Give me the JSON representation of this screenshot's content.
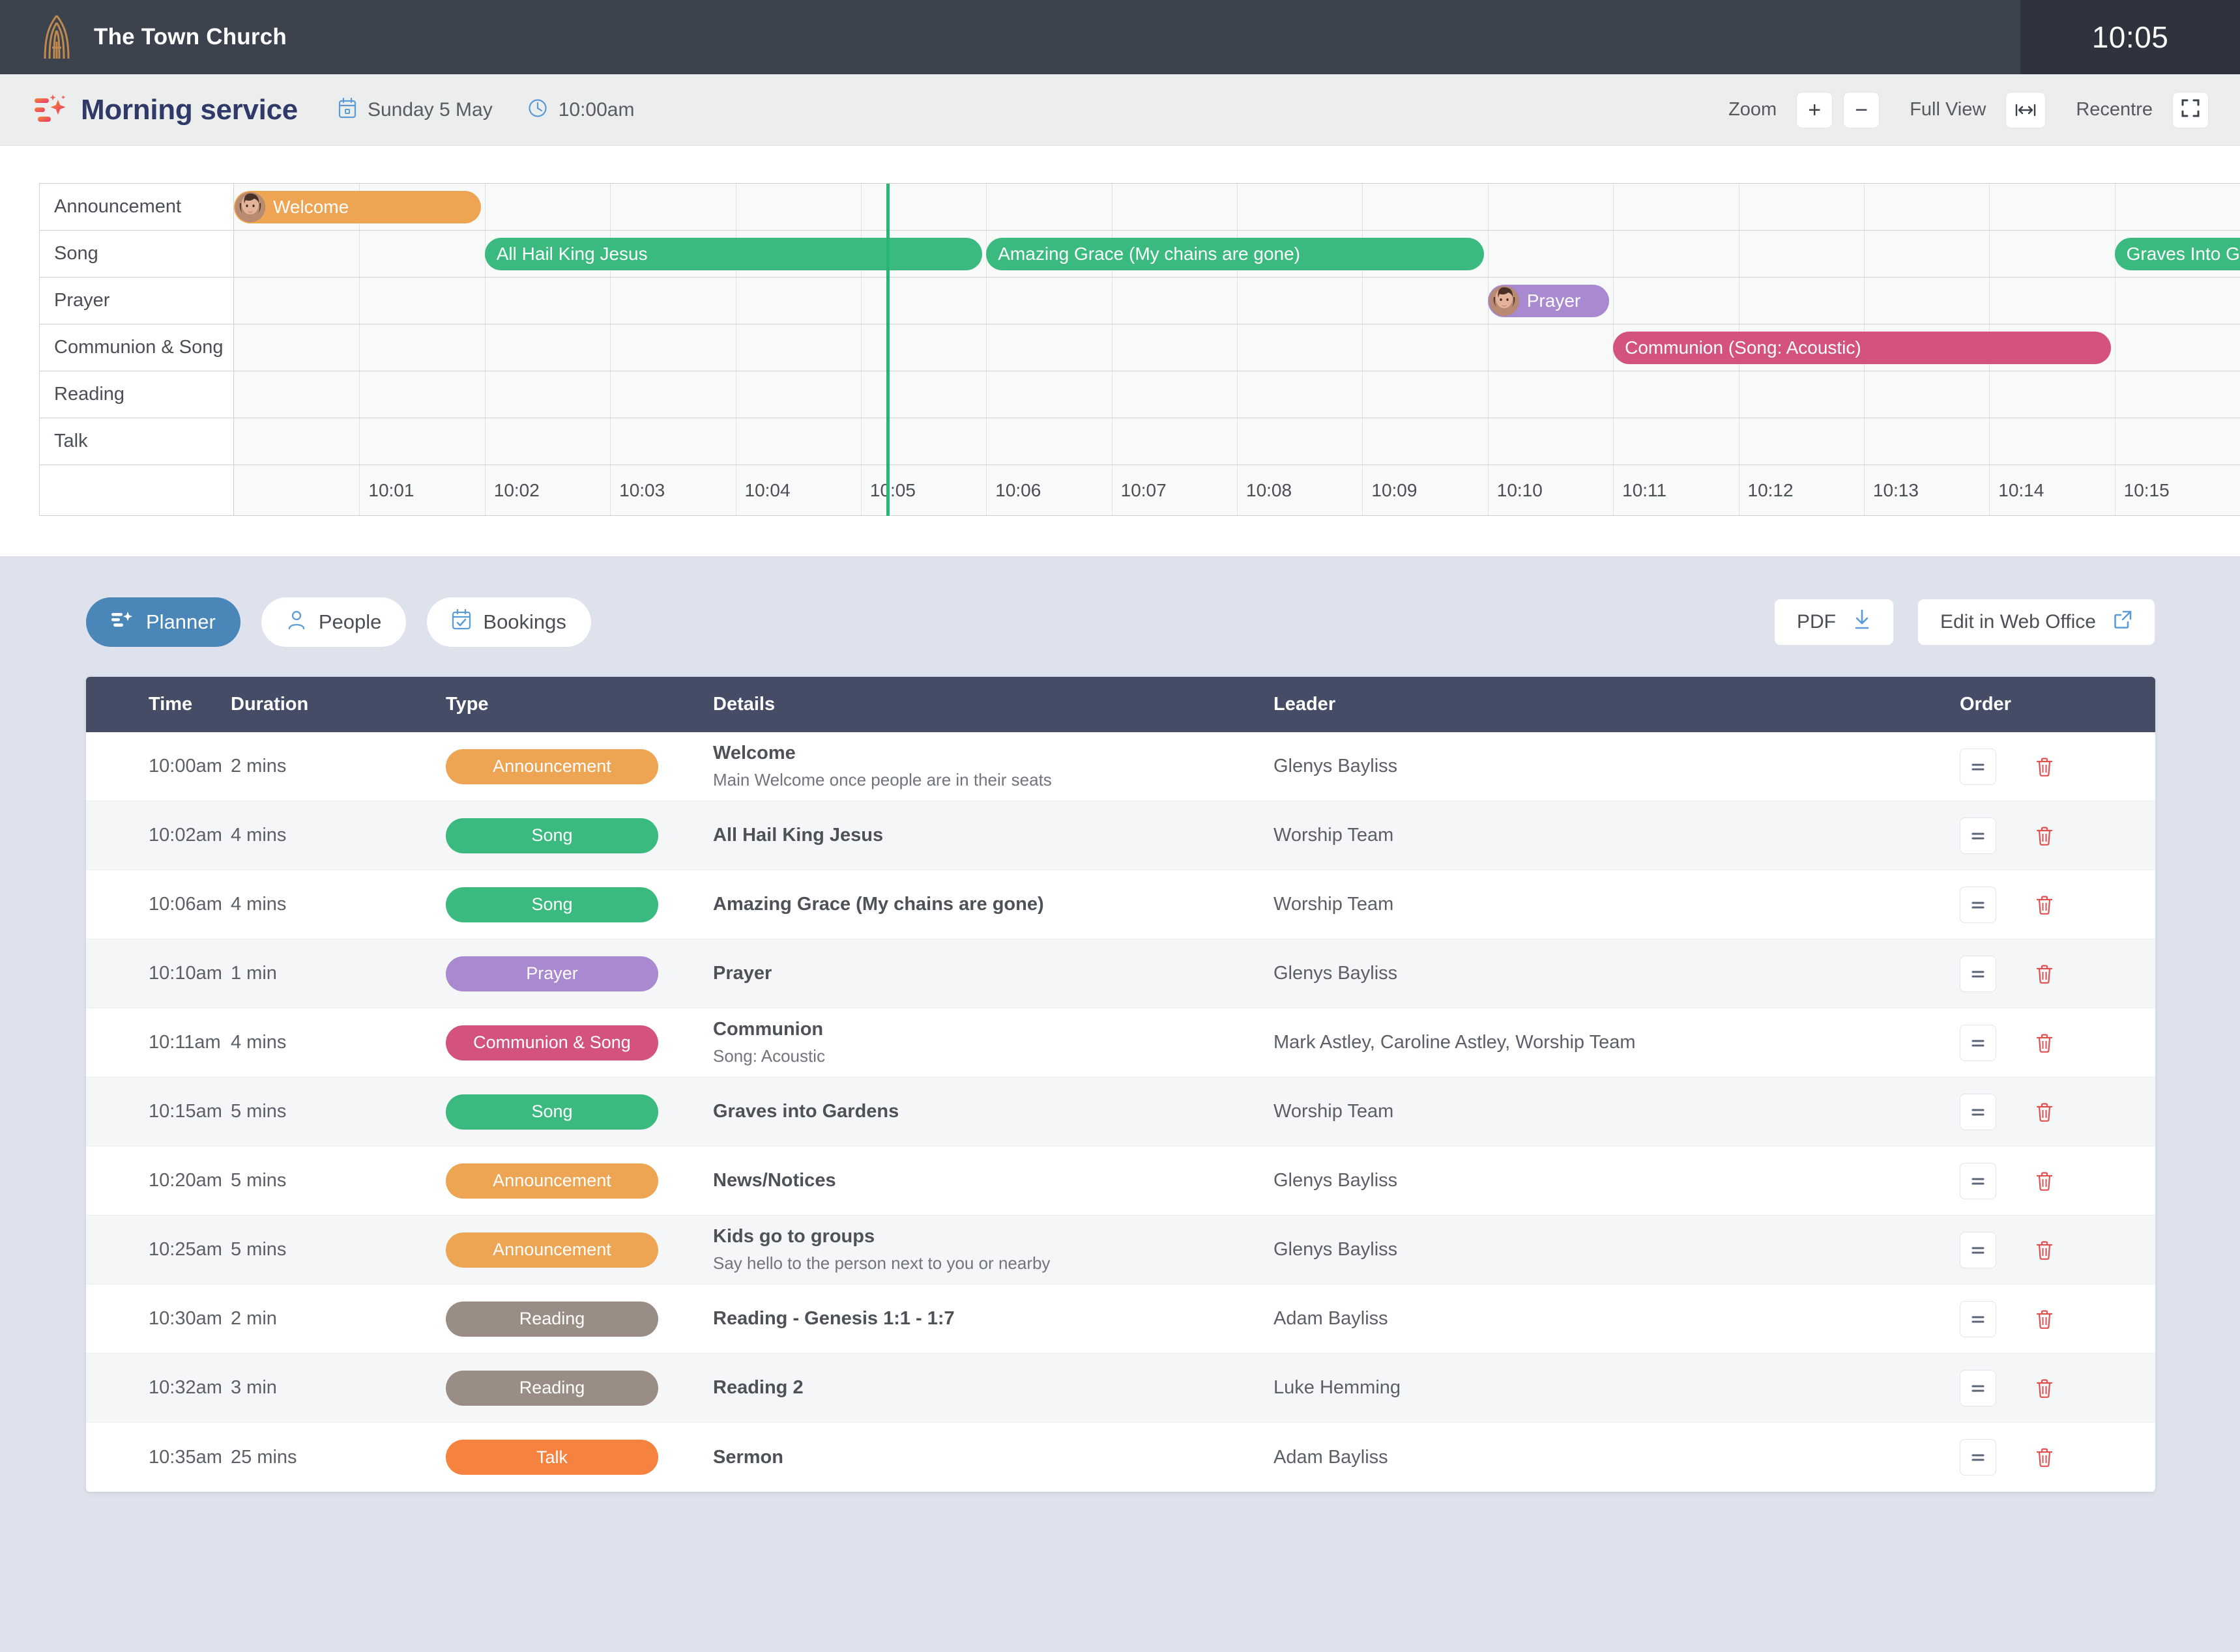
{
  "topbar": {
    "brand_name": "The Town Church",
    "logo_icon": "church-arch-cross-icon",
    "clock": "10:05"
  },
  "toolbar": {
    "planner_icon": "planner-sparkle-icon",
    "service_title": "Morning service",
    "date_icon": "calendar-icon",
    "date": "Sunday 5 May",
    "time_icon": "clock-icon",
    "time": "10:00am",
    "zoom_label": "Zoom",
    "zoom_in": "+",
    "zoom_out": "−",
    "full_view_label": "Full View",
    "full_view_icon": "fit-width-icon",
    "recentre_label": "Recentre",
    "recentre_icon": "recentre-frame-icon"
  },
  "timeline": {
    "rows": [
      {
        "label": "Announcement"
      },
      {
        "label": "Song"
      },
      {
        "label": "Prayer"
      },
      {
        "label": "Communion & Song"
      },
      {
        "label": "Reading"
      },
      {
        "label": "Talk"
      }
    ],
    "axis_ticks": [
      "10:01",
      "10:02",
      "10:03",
      "10:04",
      "10:05",
      "10:06",
      "10:07",
      "10:08",
      "10:09",
      "10:10",
      "10:11",
      "10:12",
      "10:13",
      "10:14",
      "10:15"
    ],
    "playhead_time": "10:05",
    "bars": [
      {
        "row": 0,
        "label": "Welcome",
        "color": "#eda553",
        "start_min": 0,
        "end_min": 2,
        "avatar": true
      },
      {
        "row": 1,
        "label": "All Hail King Jesus",
        "color": "#3aba7e",
        "start_min": 2,
        "end_min": 6,
        "avatar": false
      },
      {
        "row": 1,
        "label": "Amazing Grace (My chains are gone)",
        "color": "#3aba7e",
        "start_min": 6,
        "end_min": 10,
        "avatar": false
      },
      {
        "row": 1,
        "label": "Graves Into Gardens",
        "color": "#3aba7e",
        "start_min": 15,
        "end_min": 20,
        "avatar": false
      },
      {
        "row": 2,
        "label": "Prayer",
        "color": "#a98ad0",
        "start_min": 10,
        "end_min": 11,
        "avatar": true
      },
      {
        "row": 3,
        "label": "Communion (Song: Acoustic)",
        "color": "#d4527e",
        "start_min": 11,
        "end_min": 15,
        "avatar": false
      }
    ]
  },
  "tabs": [
    {
      "label": "Planner",
      "icon": "planner-sparkle-icon",
      "active": true
    },
    {
      "label": "People",
      "icon": "person-icon",
      "active": false
    },
    {
      "label": "Bookings",
      "icon": "calendar-check-icon",
      "active": false
    }
  ],
  "actions": [
    {
      "label": "PDF",
      "icon": "download-icon"
    },
    {
      "label": "Edit in Web Office",
      "icon": "external-link-icon"
    }
  ],
  "table": {
    "headers": [
      "Time",
      "Duration",
      "Type",
      "Details",
      "Leader",
      "Order"
    ],
    "handle_icon": "drag-handle-icon",
    "delete_icon": "trash-icon",
    "rows": [
      {
        "time": "10:00am",
        "duration": "2 mins",
        "type": "Announcement",
        "type_color": "#eda553",
        "details": "Welcome",
        "sub": "Main Welcome once people are in their seats",
        "leader": "Glenys Bayliss"
      },
      {
        "time": "10:02am",
        "duration": "4 mins",
        "type": "Song",
        "type_color": "#3aba7e",
        "details": "All Hail King Jesus",
        "sub": "",
        "leader": "Worship Team"
      },
      {
        "time": "10:06am",
        "duration": "4 mins",
        "type": "Song",
        "type_color": "#3aba7e",
        "details": "Amazing Grace (My chains are gone)",
        "sub": "",
        "leader": "Worship Team"
      },
      {
        "time": "10:10am",
        "duration": "1 min",
        "type": "Prayer",
        "type_color": "#a98ad0",
        "details": "Prayer",
        "sub": "",
        "leader": "Glenys Bayliss"
      },
      {
        "time": "10:11am",
        "duration": "4 mins",
        "type": "Communion & Song",
        "type_color": "#d4527e",
        "details": "Communion",
        "sub": "Song: Acoustic",
        "leader": "Mark Astley, Caroline Astley, Worship Team"
      },
      {
        "time": "10:15am",
        "duration": "5 mins",
        "type": "Song",
        "type_color": "#3aba7e",
        "details": "Graves into Gardens",
        "sub": "",
        "leader": "Worship Team"
      },
      {
        "time": "10:20am",
        "duration": "5 mins",
        "type": "Announcement",
        "type_color": "#eda553",
        "details": "News/Notices",
        "sub": "",
        "leader": "Glenys Bayliss"
      },
      {
        "time": "10:25am",
        "duration": "5 mins",
        "type": "Announcement",
        "type_color": "#eda553",
        "details": "Kids go to groups",
        "sub": "Say hello to the person next to you or nearby",
        "leader": "Glenys Bayliss"
      },
      {
        "time": "10:30am",
        "duration": "2 min",
        "type": "Reading",
        "type_color": "#9a8d86",
        "details": "Reading - Genesis 1:1 - 1:7",
        "sub": "",
        "leader": "Adam Bayliss"
      },
      {
        "time": "10:32am",
        "duration": "3 min",
        "type": "Reading",
        "type_color": "#9a8d86",
        "details": "Reading 2",
        "sub": "",
        "leader": "Luke Hemming"
      },
      {
        "time": "10:35am",
        "duration": "25 mins",
        "type": "Talk",
        "type_color": "#f5823f",
        "details": "Sermon",
        "sub": "",
        "leader": "Adam Bayliss"
      }
    ]
  },
  "colors": {
    "topbar_bg": "#3c434f",
    "clock_bg": "#2e333d",
    "accent_blue": "#4a86b8",
    "table_header_bg": "#454c66",
    "page_bg": "#dde2ec",
    "playhead": "#2ab573"
  }
}
